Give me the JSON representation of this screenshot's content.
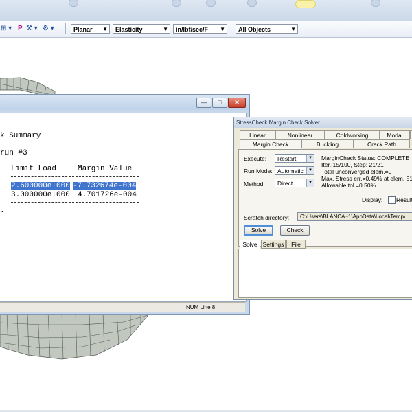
{
  "toolbar": {
    "icon_labels": [
      "⊞ ▾",
      "P",
      "⚒ ▾",
      "⚙ ▾"
    ],
    "combos": [
      "Planar",
      "Elasticity",
      "in/lbf/sec/F",
      "All Objects"
    ]
  },
  "report": {
    "lines": [
      "k Summary",
      "run #3"
    ],
    "columns": [
      "Limit Load",
      "Margin Value"
    ],
    "rows": [
      {
        "load": "2.600000e+000",
        "margin": "-7.732674e-004"
      },
      {
        "load": "3.000000e+000",
        "margin": "4.701726e-004"
      }
    ],
    "trailing": ".",
    "status": "NUM  Line 8",
    "buttons": {
      "minimize": "—",
      "maximize": "□",
      "close": "✕"
    }
  },
  "solver": {
    "title": "StressCheck Margin Check Solver",
    "tabs_row1": [
      "Linear",
      "Nonlinear",
      "Coldworking",
      "Modal",
      "N"
    ],
    "tabs_row2": [
      "Margin Check",
      "Buckling",
      "Crack Path"
    ],
    "execute_label": "Execute:",
    "execute_value": "Restart",
    "run_mode_label": "Run Mode:",
    "run_mode_value": "Automatic",
    "method_label": "Method:",
    "method_value": "Direct",
    "status_lines": [
      "MarginCheck Status: COMPLETE",
      "Iter.:15/100, Step: 21/21",
      "Total unconverged elem.=0",
      "Max. Stress err.=0.49% at elem. 51",
      "Allowable tol.=0.50%"
    ],
    "display_label": "Display:",
    "results_label": "Result",
    "scratch_label": "Scratch directory:",
    "scratch_value": "C:\\Users\\BLANCA~1\\AppData\\Local\\Temp\\",
    "solve_button": "Solve",
    "check_button": "Check",
    "lower_tabs": [
      "Solve",
      "Settings",
      "File"
    ]
  }
}
